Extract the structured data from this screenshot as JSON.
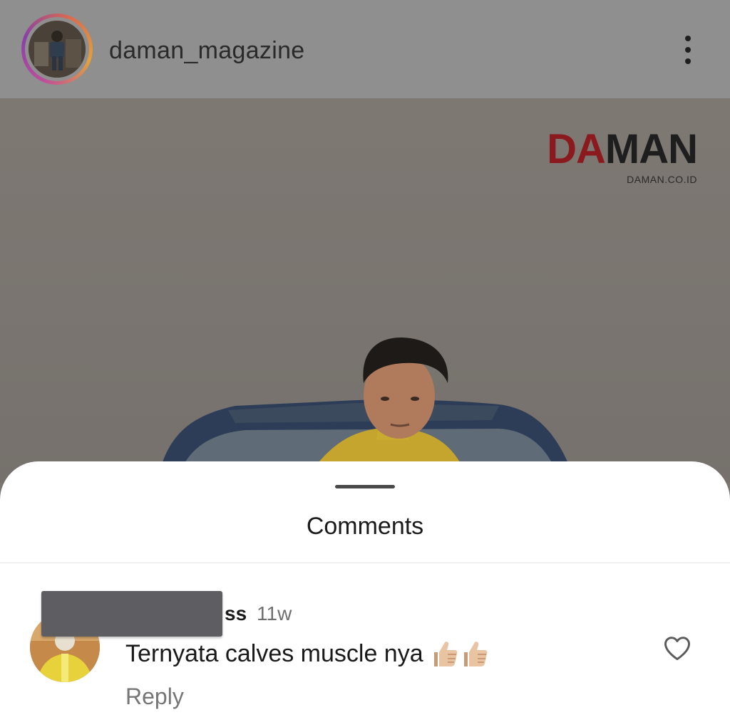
{
  "post": {
    "username": "daman_magazine",
    "brand": {
      "word_part_a": "DA",
      "word_part_b": "MAN",
      "site": "DAMAN.CO.ID"
    }
  },
  "comments_sheet": {
    "title": "Comments",
    "comment": {
      "username_visible": "ss",
      "time": "11w",
      "text": "Ternyata calves muscle nya",
      "emoji": "thumbs-up thumbs-up",
      "reply_label": "Reply"
    }
  },
  "icons": {
    "more": "vertical-ellipsis-icon",
    "like": "heart-outline-icon"
  },
  "colors": {
    "brand_red": "#8b1a1e",
    "sheet_bg": "#ffffff",
    "dim_overlay": "#8f8f8f"
  }
}
